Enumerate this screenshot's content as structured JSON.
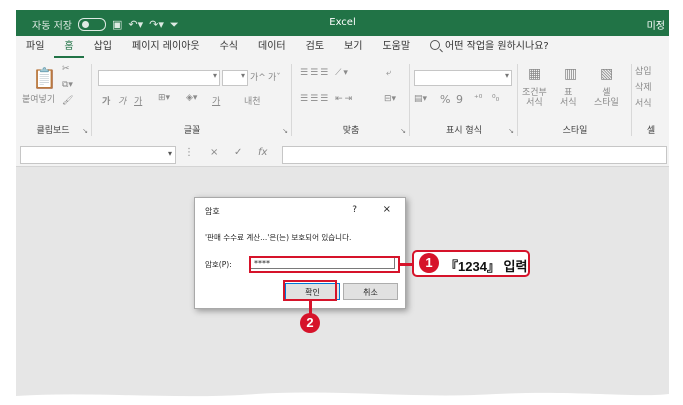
{
  "titlebar": {
    "autosave_label": "자동 저장",
    "toggle_state": "끔",
    "title": "Excel",
    "user": "미정"
  },
  "menu": {
    "tabs": [
      "파일",
      "홈",
      "삽입",
      "페이지 레이아웃",
      "수식",
      "데이터",
      "검토",
      "보기",
      "도움말"
    ],
    "active_tab": "홈",
    "tell_me": "어떤 작업을 원하시나요?"
  },
  "ribbon": {
    "groups": [
      "클립보드",
      "글꼴",
      "맞춤",
      "표시 형식",
      "스타일",
      "셀"
    ],
    "clipboard": {
      "paste": "붙여넣기"
    },
    "font": {
      "bold": "가",
      "italic": "가",
      "underline": "가",
      "size_up": "가^",
      "size_down": "가ˇ",
      "font_color": "가",
      "phonetic": "내천"
    },
    "number": {
      "percent": "%",
      "comma": "9"
    },
    "styles": {
      "conditional": "조건부\n서식",
      "table": "표\n서식",
      "cell": "셀\n스타일"
    },
    "cells": {
      "insert": "삽입",
      "delete": "삭제",
      "format": "서식"
    }
  },
  "formula_bar": {
    "cancel": "×",
    "enter": "✓",
    "fx": "fx"
  },
  "dialog": {
    "title": "암호",
    "help": "?",
    "close": "×",
    "message": "'판매 수수료 계산...'은(는) 보호되어 있습니다.",
    "password_label": "암호(P):",
    "password_value": "****",
    "ok": "확인",
    "cancel": "취소"
  },
  "annotations": {
    "step1_number": "1",
    "step1_text": "『1234』 입력",
    "step2_number": "2",
    "color": "#d6132a"
  },
  "colors": {
    "excel_green": "#217346"
  }
}
